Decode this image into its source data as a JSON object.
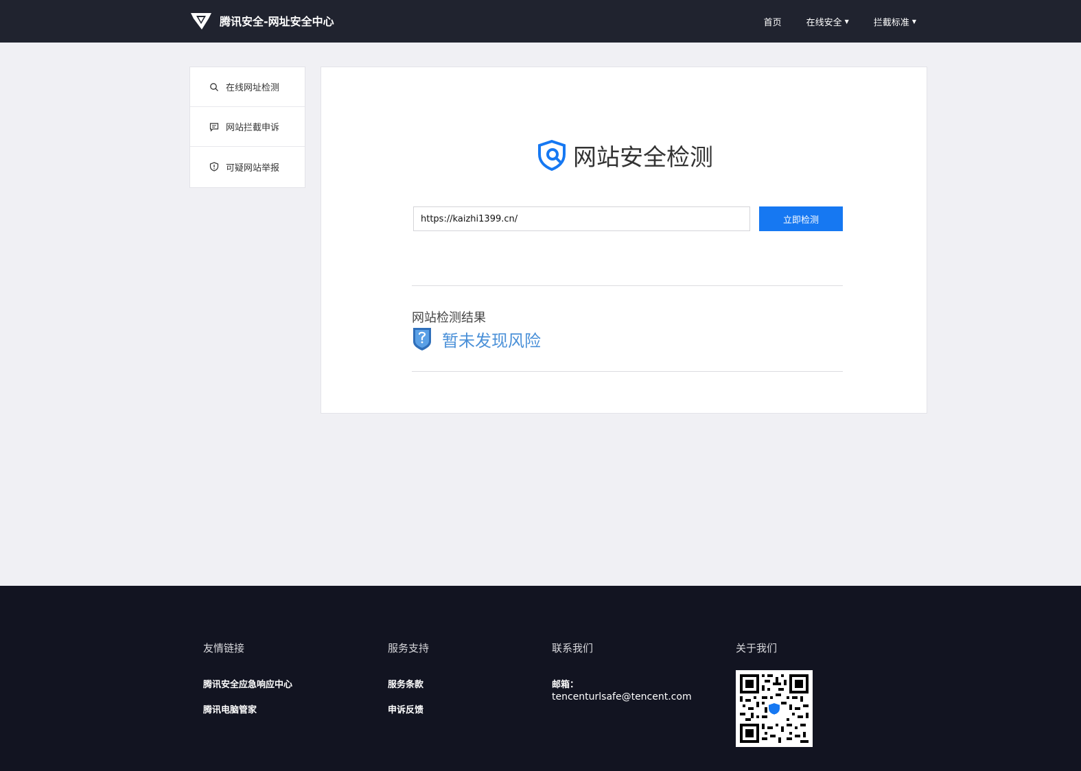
{
  "header": {
    "brand_title": "腾讯安全-网址安全中心",
    "nav": [
      {
        "label": "首页",
        "has_caret": false
      },
      {
        "label": "在线安全",
        "has_caret": true
      },
      {
        "label": "拦截标准",
        "has_caret": true
      }
    ]
  },
  "sidebar": {
    "items": [
      {
        "label": "在线网址检测",
        "icon": "search-icon"
      },
      {
        "label": "网站拦截申诉",
        "icon": "message-icon"
      },
      {
        "label": "可疑网站举报",
        "icon": "shield-alert-icon"
      }
    ]
  },
  "main": {
    "title": "网站安全检测",
    "search_value": "https://kaizhi1399.cn/",
    "check_button": "立即检测",
    "result_label": "网站检测结果",
    "result_text": "暂未发现风险"
  },
  "footer": {
    "col1": {
      "title": "友情链接",
      "links": [
        "腾讯安全应急响应中心",
        "腾讯电脑管家"
      ]
    },
    "col2": {
      "title": "服务支持",
      "links": [
        "服务条款",
        "申诉反馈"
      ]
    },
    "col3": {
      "title": "联系我们",
      "mail_label": "邮箱：",
      "mail_value": "tencenturlsafe@tencent.com"
    },
    "col4": {
      "title": "关于我们"
    }
  },
  "colors": {
    "header_bg": "#20232f",
    "footer_bg": "#121421",
    "accent_blue": "#1678f2",
    "result_blue": "#4a90d8"
  }
}
